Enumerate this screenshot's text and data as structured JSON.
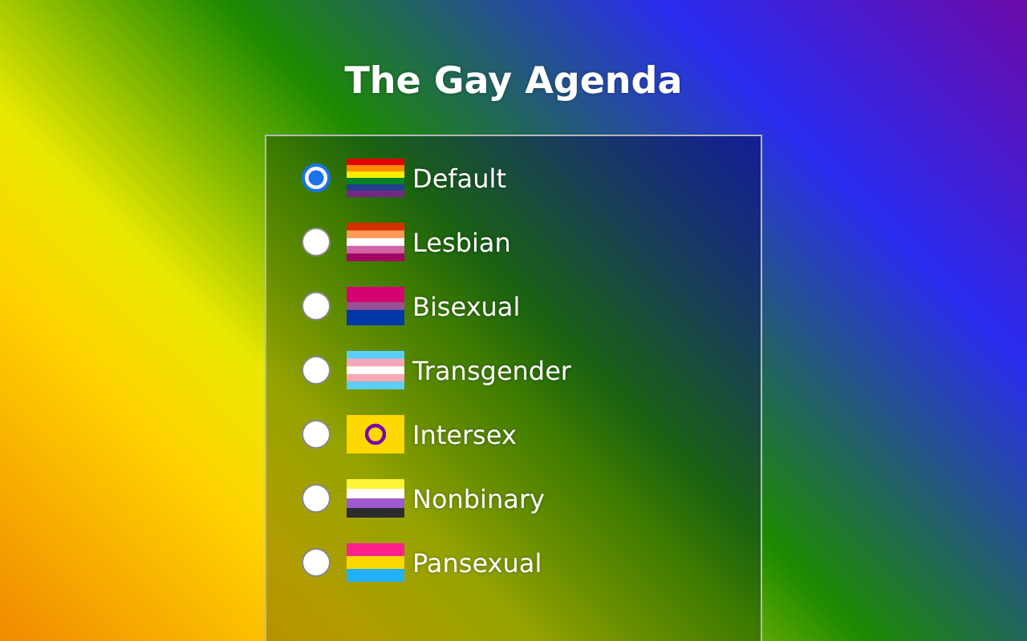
{
  "title": "The Gay Agenda",
  "options": [
    {
      "label": "Default",
      "kind": "rainbow",
      "selected": true
    },
    {
      "label": "Lesbian",
      "kind": "lesbian",
      "selected": false
    },
    {
      "label": "Bisexual",
      "kind": "bisexual",
      "selected": false
    },
    {
      "label": "Transgender",
      "kind": "transgender",
      "selected": false
    },
    {
      "label": "Intersex",
      "kind": "intersex",
      "selected": false
    },
    {
      "label": "Nonbinary",
      "kind": "nonbinary",
      "selected": false
    },
    {
      "label": "Pansexual",
      "kind": "pansexual",
      "selected": false
    }
  ]
}
